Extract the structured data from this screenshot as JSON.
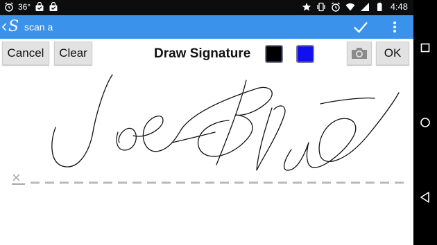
{
  "status_bar": {
    "temperature": "36°",
    "time": "4:48",
    "left_icons": [
      "alarm-icon",
      "bag-icon",
      "bag-check-icon"
    ],
    "right_icons": [
      "star-icon",
      "vibrate-icon",
      "alarm-icon",
      "wifi-icon",
      "signal-icon",
      "battery-icon"
    ]
  },
  "action_bar": {
    "title": "scan a",
    "app_logo": "S",
    "accent_color": "#3a92ea",
    "actions": [
      "check-icon",
      "overflow-menu-icon"
    ]
  },
  "toolbar": {
    "cancel_label": "Cancel",
    "clear_label": "Clear",
    "title": "Draw Signature",
    "ok_label": "OK",
    "colors": [
      "#000000",
      "#1010ee"
    ]
  },
  "signature_pad": {
    "line_marker": "×"
  },
  "nav_bar": {
    "buttons": [
      "recents-square-icon",
      "home-circle-icon",
      "back-triangle-icon"
    ]
  }
}
